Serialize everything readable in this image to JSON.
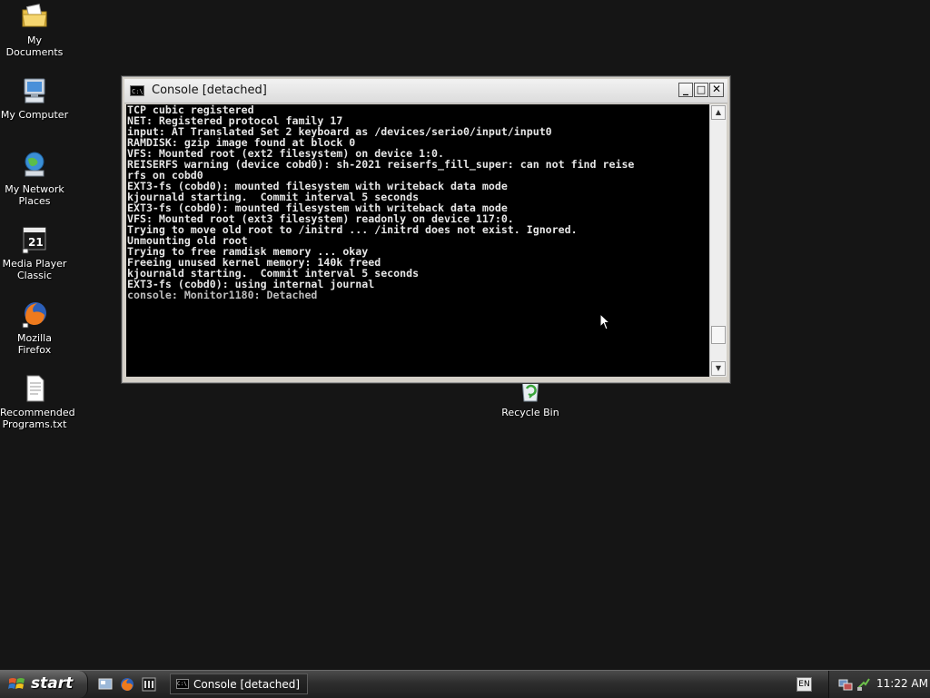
{
  "desktop_icons": [
    {
      "label": "My Documents",
      "icon": "folder-documents-icon"
    },
    {
      "label": "My Computer",
      "icon": "computer-icon"
    },
    {
      "label": "My Network Places",
      "icon": "network-places-icon"
    },
    {
      "label": "Media Player Classic",
      "icon": "media-player-icon"
    },
    {
      "label": "Mozilla Firefox",
      "icon": "firefox-icon"
    },
    {
      "label": "Recommended Programs.txt",
      "icon": "text-file-icon"
    },
    {
      "label": "Recycle Bin",
      "icon": "recycle-bin-icon"
    }
  ],
  "window": {
    "title": "Console [detached]",
    "minimize_label": "_",
    "maximize_label": "□",
    "close_label": "✕"
  },
  "console": {
    "lines": [
      "TCP cubic registered",
      "NET: Registered protocol family 17",
      "input: AT Translated Set 2 keyboard as /devices/serio0/input/input0",
      "RAMDISK: gzip image found at block 0",
      "VFS: Mounted root (ext2 filesystem) on device 1:0.",
      "REISERFS warning (device cobd0): sh-2021 reiserfs_fill_super: can not find reise",
      "rfs on cobd0",
      "EXT3-fs (cobd0): mounted filesystem with writeback data mode",
      "kjournald starting.  Commit interval 5 seconds",
      "EXT3-fs (cobd0): mounted filesystem with writeback data mode",
      "VFS: Mounted root (ext3 filesystem) readonly on device 117:0.",
      "Trying to move old root to /initrd ... /initrd does not exist. Ignored.",
      "Unmounting old root",
      "Trying to free ramdisk memory ... okay",
      "Freeing unused kernel memory: 140k freed",
      "kjournald starting.  Commit interval 5 seconds",
      "EXT3-fs (cobd0): using internal journal",
      "console: Monitor1180: Detached"
    ]
  },
  "taskbar": {
    "start_label": "start",
    "quick_launch": [
      "show-desktop-icon",
      "firefox-icon",
      "media-player-icon"
    ],
    "tasks": [
      {
        "label": "Console [detached]"
      }
    ],
    "language": "EN",
    "clock": "11:22 AM"
  }
}
